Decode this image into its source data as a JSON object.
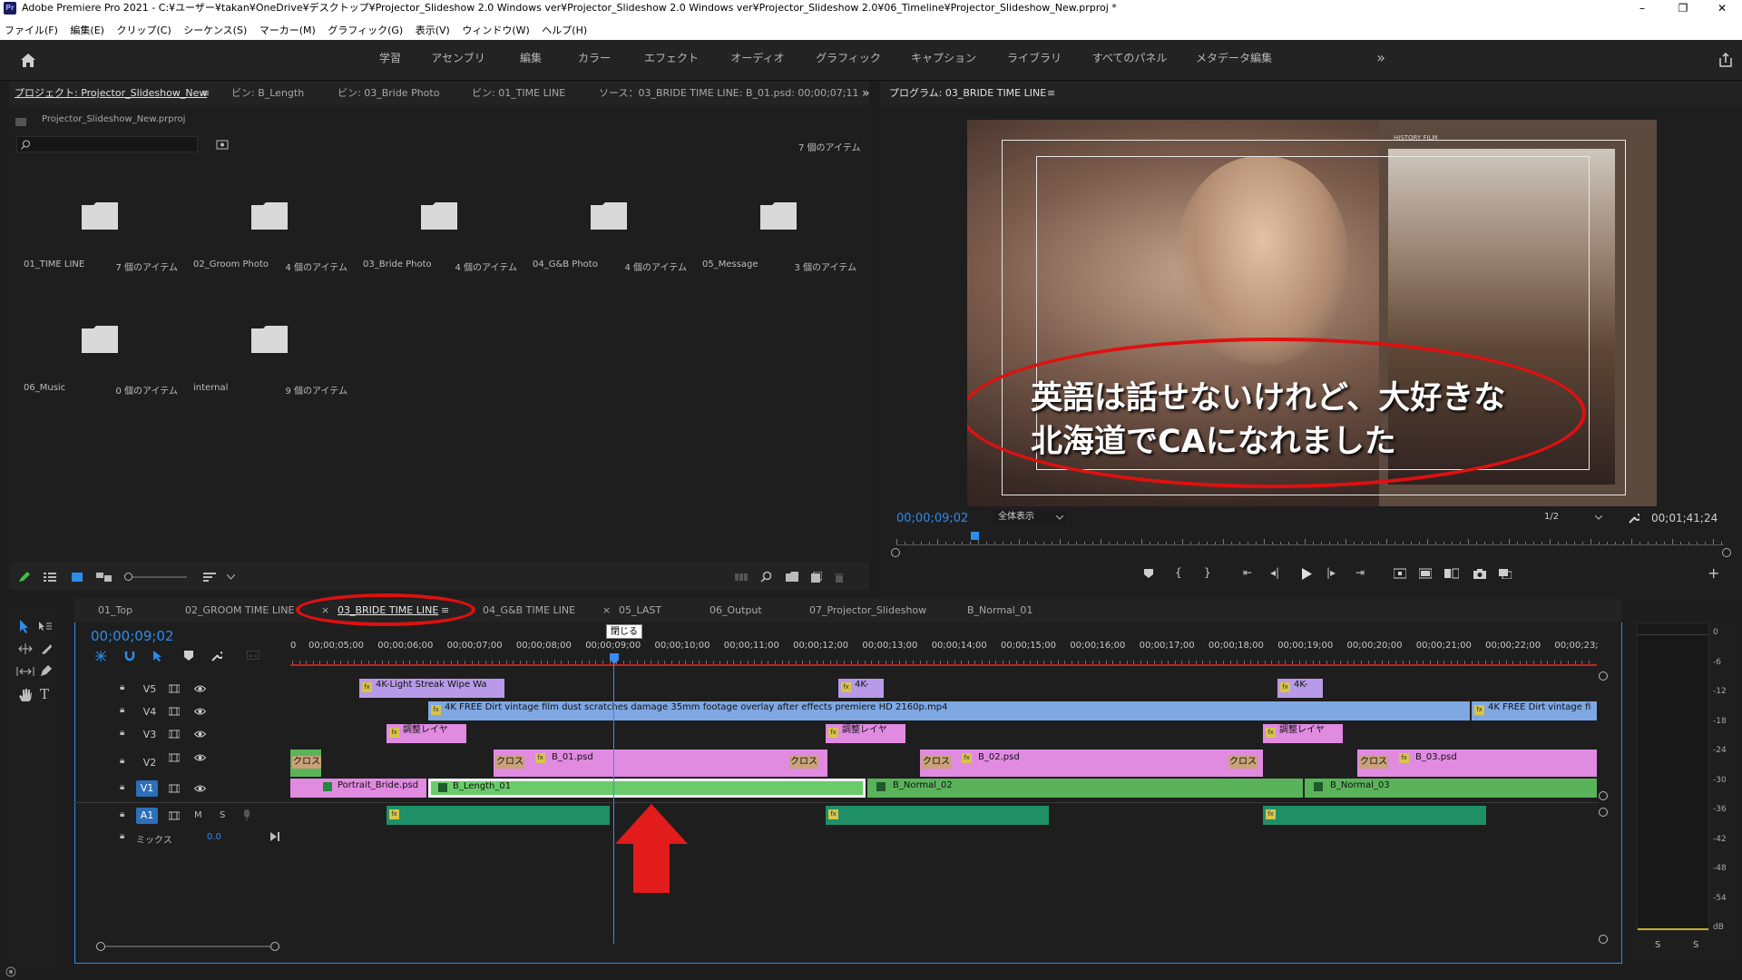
{
  "title_bar": {
    "app_icon": "Pr",
    "title": "Adobe Premiere Pro 2021 - C:¥ユーザー¥takan¥OneDrive¥デスクトップ¥Projector_Slideshow 2.0 Windows ver¥Projector_Slideshow 2.0 Windows ver¥Projector_Slideshow 2.0¥06_Timeline¥Projector_Slideshow_New.prproj *",
    "controls": [
      "–",
      "❐",
      "✕"
    ]
  },
  "menu": [
    "ファイル(F)",
    "編集(E)",
    "クリップ(C)",
    "シーケンス(S)",
    "マーカー(M)",
    "グラフィック(G)",
    "表示(V)",
    "ウィンドウ(W)",
    "ヘルプ(H)"
  ],
  "workspaces": {
    "tabs": [
      "学習",
      "アセンブリ",
      "編集",
      "カラー",
      "エフェクト",
      "オーディオ",
      "グラフィック",
      "キャプション",
      "ライブラリ",
      "すべてのパネル",
      "メタデータ編集"
    ],
    "more": "»"
  },
  "project_panel": {
    "tabs": [
      "プロジェクト: Projector_Slideshow_New",
      "ビン: B_Length",
      "ビン: 03_Bride Photo",
      "ビン: 01_TIME LINE",
      "ソース：03_BRIDE TIME LINE: B_01.psd: 00;00;07;11"
    ],
    "menu_icon": "≡",
    "more": "»",
    "file": "Projector_Slideshow_New.prproj",
    "search_value": "",
    "item_count": "7 個のアイテム",
    "folders": [
      {
        "name": "01_TIME LINE",
        "count": "7 個のアイテム"
      },
      {
        "name": "02_Groom Photo",
        "count": "4 個のアイテム"
      },
      {
        "name": "03_Bride Photo",
        "count": "4 個のアイテム"
      },
      {
        "name": "04_G&B Photo",
        "count": "4 個のアイテム"
      },
      {
        "name": "05_Message",
        "count": "3 個のアイテム"
      },
      {
        "name": "06_Music",
        "count": "0 個のアイテム"
      },
      {
        "name": "internal",
        "count": "9 個のアイテム"
      }
    ]
  },
  "program_monitor": {
    "title": "プログラム: 03_BRIDE TIME LINE",
    "caption_line1": "英語は話せないけれど、大好きな",
    "caption_line2": "北海道でCAになれました",
    "badge_top": "HISTORY FILM",
    "timecode": "00;00;09;02",
    "zoom": "全体表示",
    "resolution": "1/2",
    "duration": "00;01;41;24",
    "playhead_fraction": 0.09
  },
  "timeline": {
    "tabs": [
      "01_Top",
      "02_GROOM TIME LINE",
      "03_BRIDE TIME LINE",
      "04_G&B TIME LINE",
      "05_LAST",
      "06_Output",
      "07_Projector_Slideshow",
      "B_Normal_01"
    ],
    "active_tab": "03_BRIDE TIME LINE",
    "timecode": "00;00;09;02",
    "tooltip": "閉じる",
    "ruler": [
      "0",
      "00;00;05;00",
      "00;00;06;00",
      "00;00;07;00",
      "00;00;08;00",
      "00;00;09;00",
      "00;00;10;00",
      "00;00;11;00",
      "00;00;12;00",
      "00;00;13;00",
      "00;00;14;00",
      "00;00;15;00",
      "00;00;16;00",
      "00;00;17;00",
      "00;00;18;00",
      "00;00;19;00",
      "00;00;20;00",
      "00;00;21;00",
      "00;00;22;00",
      "00;00;23;"
    ],
    "tracks": [
      "V5",
      "V4",
      "V3",
      "V2",
      "V1",
      "A1"
    ],
    "mix_label": "ミックス",
    "mix_value": "0.0",
    "clips": {
      "v5": [
        "4K-Light Streak Wipe Wa",
        "4K-",
        "4K-"
      ],
      "v4": [
        "4K FREE Dirt vintage film dust scratches damage 35mm footage overlay after effects premiere HD 2160p.mp4",
        "4K FREE Dirt vintage fi"
      ],
      "v3": [
        "調整レイヤ",
        "調整レイヤ",
        "調整レイヤ"
      ],
      "v2": [
        "クロス",
        "クロス",
        "B_01.psd",
        "クロス",
        "クロス",
        "B_02.psd",
        "クロス",
        "クロス",
        "B_03.psd"
      ],
      "v1": [
        "Portrait_Bride.psd",
        "B_Length_01",
        "B_Normal_02",
        "B_Normal_03"
      ]
    }
  },
  "audio_meter": {
    "scale": [
      "0",
      "-6",
      "-12",
      "-18",
      "-24",
      "-30",
      "-36",
      "-42",
      "-48",
      "-54",
      "dB"
    ],
    "solo": [
      "S",
      "S"
    ]
  },
  "colors": {
    "accent": "#2d8ceb",
    "annotation": "#e01010",
    "playhead": "#3b8bf0"
  }
}
